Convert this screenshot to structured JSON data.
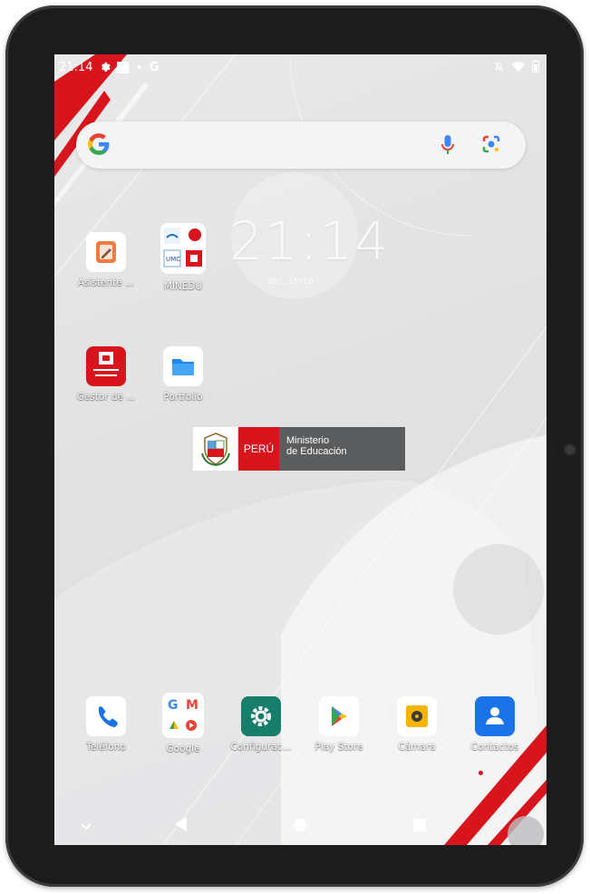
{
  "status_bar": {
    "time": "21:14",
    "left_icons": [
      "settings-icon",
      "notification-square-icon",
      "dot-icon",
      "google-g-icon"
    ],
    "right_icons": [
      "mute-icon",
      "wifi-icon",
      "battery-icon"
    ]
  },
  "search_bar": {
    "logo": "google-g-icon",
    "mic": "microphone-icon",
    "lens": "google-lens-icon"
  },
  "clock_widget": {
    "time": "21:14",
    "date": "20?., 15 FEB"
  },
  "home_apps": [
    {
      "label": "Asistente ...",
      "icon": "assistant-icon"
    },
    {
      "label": "MINEDU",
      "icon": "folder-icon"
    },
    {
      "label": "Gestor de ...",
      "icon": "content-manager-icon"
    },
    {
      "label": "Portfolio",
      "icon": "folder-blue-icon"
    }
  ],
  "banner": {
    "peru": "PERÚ",
    "ministry_line1": "Ministerio",
    "ministry_line2": "de Educación"
  },
  "dock_apps": [
    {
      "label": "Teléfono",
      "icon": "phone-icon"
    },
    {
      "label": "Google",
      "icon": "google-folder-icon"
    },
    {
      "label": "Configurac...",
      "icon": "settings-gear-icon"
    },
    {
      "label": "Play Store",
      "icon": "play-store-icon"
    },
    {
      "label": "Cámara",
      "icon": "camera-icon"
    },
    {
      "label": "Contactos",
      "icon": "contacts-icon"
    }
  ],
  "nav_bar": [
    "chevron-down-icon",
    "back-icon",
    "home-icon",
    "recents-icon"
  ],
  "colors": {
    "accent_red": "#d8141d",
    "bezel": "#1c1c1c",
    "gray_banner": "#5b5c5e"
  }
}
